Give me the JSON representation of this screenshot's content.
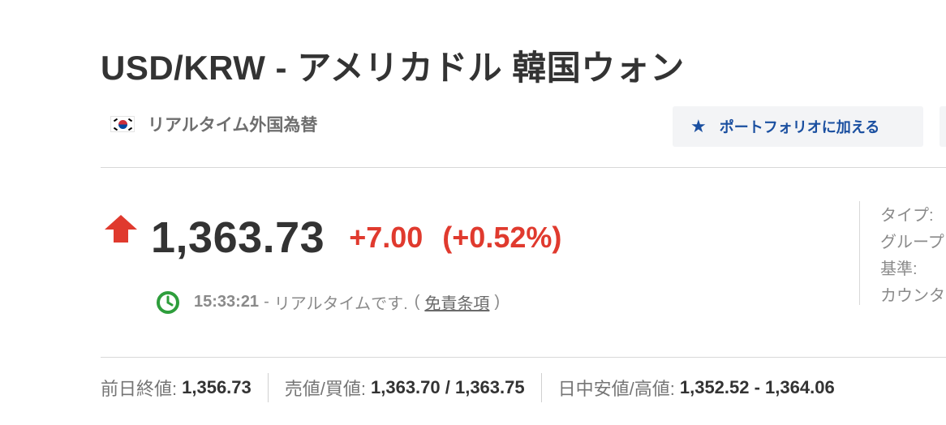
{
  "header": {
    "title": "USD/KRW - アメリカドル 韓国ウォン"
  },
  "source": {
    "flag_icon": "south-korea-flag-icon",
    "label": "リアルタイム外国為替"
  },
  "actions": {
    "portfolio_icon": "star-icon",
    "portfolio_label": "ポートフォリオに加える"
  },
  "quote": {
    "direction": "up",
    "price": "1,363.73",
    "change": "+7.00",
    "change_pct": "(+0.52%)",
    "time": "15:33:21",
    "time_separator": "-",
    "realtime_note": "リアルタイムです.",
    "paren_open": "(",
    "disclaimer_link": "免責条項",
    "paren_close": ")"
  },
  "info": {
    "type_label": "タイプ:",
    "group_label": "グループ",
    "base_label": "基準:",
    "counter_label": "カウンタ"
  },
  "stats": {
    "prev_close_label": "前日終値:",
    "prev_close_value": "1,356.73",
    "bid_ask_label": "売値/買値:",
    "bid_ask_value": "1,363.70 / 1,363.75",
    "day_range_label": "日中安値/高値:",
    "day_range_value": "1,352.52 - 1,364.06"
  },
  "colors": {
    "positive": "#e03a2e",
    "link_blue": "#1a4fa0",
    "clock_green": "#2e9e3c"
  }
}
